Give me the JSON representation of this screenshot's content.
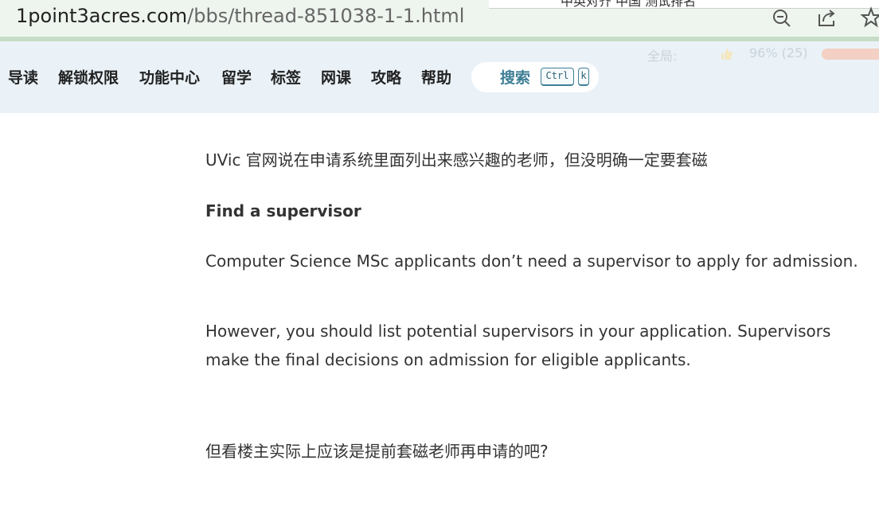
{
  "browser": {
    "url_domain": "1point3acres.com",
    "url_path": "/bbs/thread-851038-1-1.html",
    "overlay_text": "中英对齐 中国 测试排名"
  },
  "site_nav": {
    "items": [
      "导读",
      "解锁权限",
      "功能中心",
      "留学",
      "标签",
      "网课",
      "攻略",
      "帮助"
    ],
    "search_label": "搜索",
    "shortcut_key_1": "Ctrl",
    "shortcut_key_2": "k",
    "stats_label": "全局:",
    "stats_value": "96% (25)",
    "rating_percent": 96
  },
  "post": {
    "para1": "UVic 官网说在申请系统里面列出来感兴趣的老师，但没明确一定要套磁",
    "heading": "Find a supervisor",
    "para2": "Computer Science MSc applicants don’t need a supervisor to apply for admission.",
    "para3_line1": "However, you should list potential supervisors in your application. Supervisors",
    "para3_line2": "make the final decisions on admission for eligible applicants.",
    "para4": "但看楼主实际上应该是提前套磁老师再申请的吧?"
  },
  "colors": {
    "nav_bg": "#eaf2f8",
    "search_accent": "#3e7f96",
    "browser_bar": "#eef5ee"
  }
}
